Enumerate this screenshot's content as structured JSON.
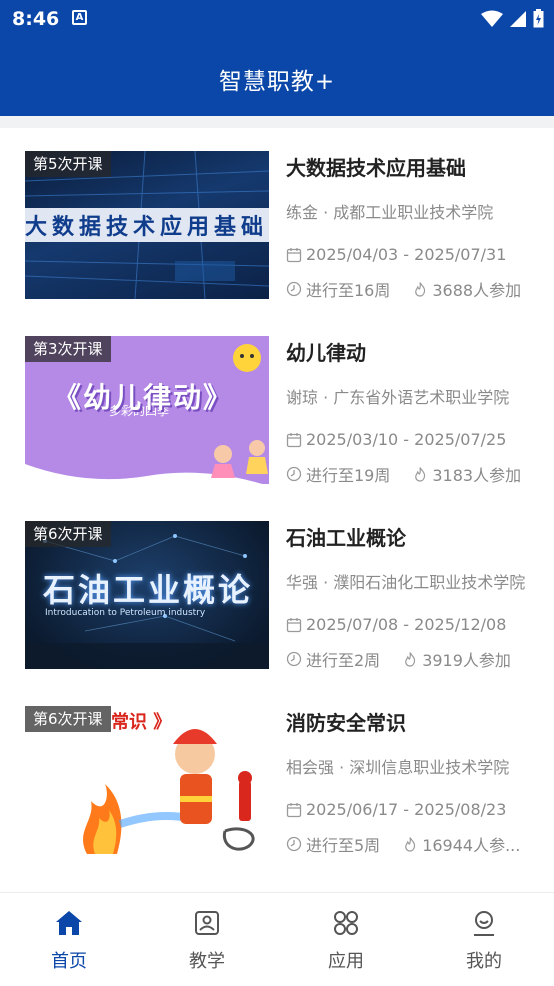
{
  "status_bar": {
    "time": "8:46",
    "notification": "A"
  },
  "app_bar": {
    "title": "智慧职教+"
  },
  "courses": [
    {
      "tag": "第5次开课",
      "title": "大数据技术应用基础",
      "teacher": "练金 · 成都工业职业技术学院",
      "dates": "2025/04/03 - 2025/07/31",
      "progress": "进行至16周",
      "participants": "3688人参加",
      "cover_text": "大数据技术应用基础"
    },
    {
      "tag": "第3次开课",
      "title": "幼儿律动",
      "teacher": "谢琼 · 广东省外语艺术职业学院",
      "dates": "2025/03/10 - 2025/07/25",
      "progress": "进行至19周",
      "participants": "3183人参加",
      "cover_text": "《幼儿律动》",
      "cover_sub": "多彩的四季"
    },
    {
      "tag": "第6次开课",
      "title": "石油工业概论",
      "teacher": "华强 · 濮阳石油化工职业技术学院",
      "dates": "2025/07/08 - 2025/12/08",
      "progress": "进行至2周",
      "participants": "3919人参加",
      "cover_text": "石油工业概论",
      "cover_sub": "Introducation to Petroleum industry"
    },
    {
      "tag": "第6次开课",
      "title": "消防安全常识",
      "teacher": "相会强 · 深圳信息职业技术学院",
      "dates": "2025/06/17 - 2025/08/23",
      "progress": "进行至5周",
      "participants": "16944人参...",
      "cover_text": "常识 》"
    }
  ],
  "bottom_nav": [
    {
      "label": "首页",
      "icon": "home-icon",
      "active": true
    },
    {
      "label": "教学",
      "icon": "teaching-icon",
      "active": false
    },
    {
      "label": "应用",
      "icon": "apps-icon",
      "active": false
    },
    {
      "label": "我的",
      "icon": "profile-icon",
      "active": false
    }
  ],
  "colors": {
    "primary": "#0a47a8",
    "text_secondary": "#8a8a8a"
  }
}
